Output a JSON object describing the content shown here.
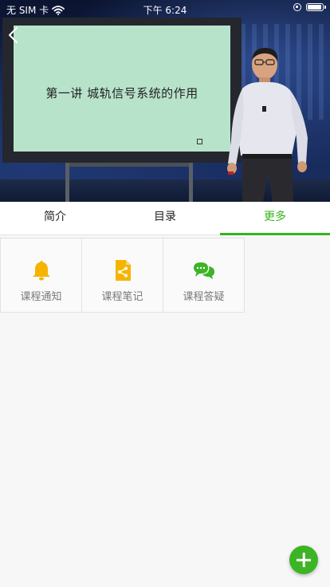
{
  "status_bar": {
    "carrier": "无 SIM 卡",
    "time": "下午 6:24"
  },
  "video": {
    "board_title": "第一讲 城轨信号系统的作用"
  },
  "tabs": [
    {
      "label": "简介",
      "active": false
    },
    {
      "label": "目录",
      "active": false
    },
    {
      "label": "更多",
      "active": true
    }
  ],
  "features": [
    {
      "label": "课程通知",
      "icon": "bell-icon",
      "color": "#f5b400"
    },
    {
      "label": "课程笔记",
      "icon": "share-document-icon",
      "color": "#f5b400"
    },
    {
      "label": "课程答疑",
      "icon": "chat-bubbles-icon",
      "color": "#3cb424"
    }
  ],
  "colors": {
    "accent": "#35b41a",
    "fab": "#3cb424"
  }
}
